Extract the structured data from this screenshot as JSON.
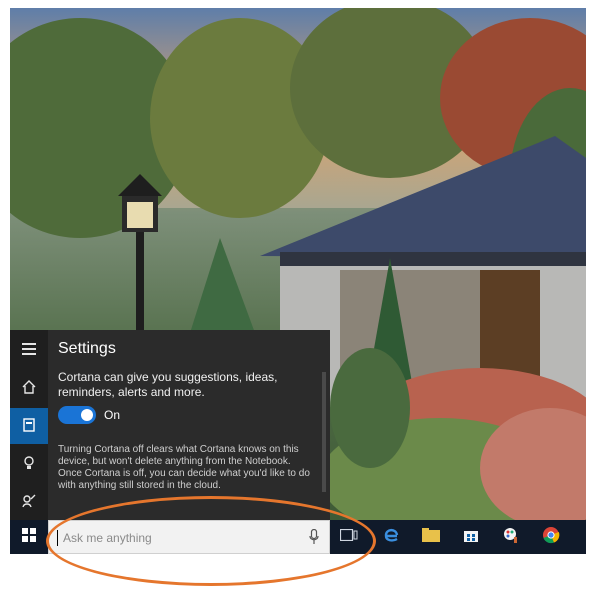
{
  "cortana": {
    "title": "Settings",
    "description": "Cortana can give you suggestions, ideas, reminders, alerts and more.",
    "toggle": {
      "state": "On",
      "on": true
    },
    "info": "Turning Cortana off clears what Cortana knows on this device, but won't delete anything from the Notebook. Once Cortana is off, you can decide what you'd like to do with anything still stored in the cloud.",
    "rail_icons": [
      "hamburger-icon",
      "home-icon",
      "notebook-icon",
      "lightbulb-icon",
      "feedback-icon"
    ]
  },
  "taskbar": {
    "search": {
      "placeholder": "Ask me anything",
      "value": ""
    },
    "icons": [
      "windows-start-icon",
      "microphone-icon",
      "task-view-icon",
      "edge-icon",
      "file-explorer-icon",
      "store-icon",
      "paint-icon",
      "chrome-icon"
    ]
  },
  "colors": {
    "accent": "#1a74d6",
    "active_rail": "#0f5fa3",
    "panel": "#2b2b2b",
    "taskbar": "#101a2a",
    "callout": "#e5762d"
  }
}
